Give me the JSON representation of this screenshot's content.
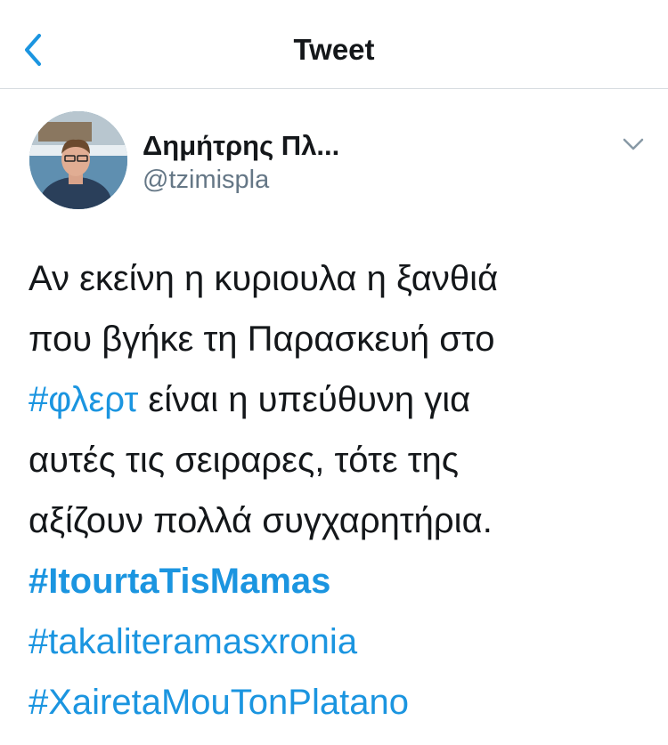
{
  "header": {
    "title": "Tweet"
  },
  "author": {
    "display_name": "Δημήτρης Πλ...",
    "handle": "@tzimispla"
  },
  "tweet": {
    "line1": "Αν εκείνη η κυριουλα η ξανθιά",
    "line2": "που βγήκε τη Παρασκευή στο",
    "line3_hashtag": "#φλερτ",
    "line3_rest": " είναι η υπεύθυνη για",
    "line4": "αυτές τις σειραρες, τότε της",
    "line5": "αξίζουν πολλά συγχαρητήρια.",
    "hashtag1": "#ItourtaTisMamas",
    "hashtag2": "#takaliteramasxronia",
    "hashtag3": "#XairetaMouTonPlatano"
  },
  "colors": {
    "accent": "#1b95e0",
    "text": "#14171a",
    "secondary_text": "#657786",
    "divider": "#d8dde1"
  },
  "icons": {
    "back": "chevron-left-icon",
    "more": "chevron-down-icon"
  }
}
